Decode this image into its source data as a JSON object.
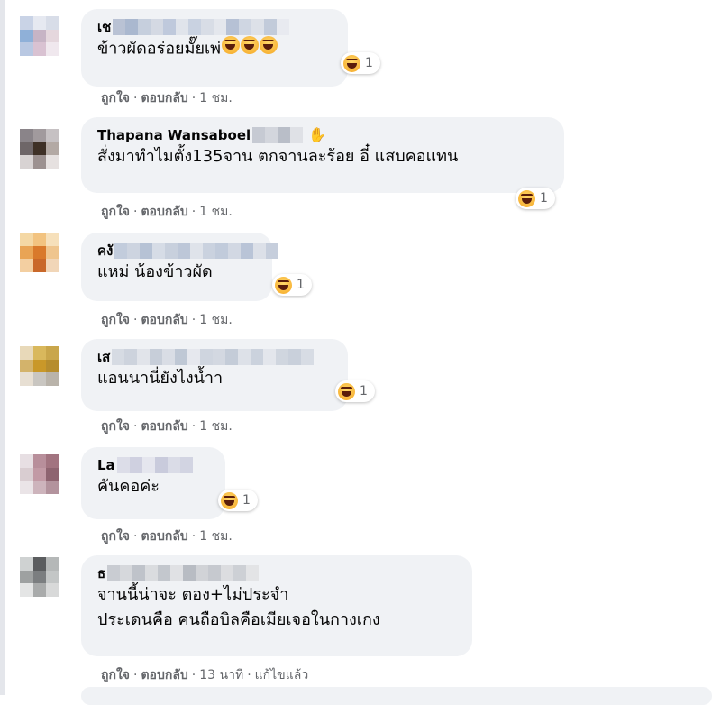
{
  "comments": [
    {
      "name": "เช",
      "text": "ข้าวผัดอร่อยมั๊ยเพ่",
      "reaction_count": "1",
      "meta": {
        "like": "ถูกใจ",
        "reply": "ตอบกลับ",
        "time": "1 ชม."
      },
      "avatar_colors": [
        "#c9d3e6",
        "#e6e9f1",
        "#d8dde8",
        "#8fb0d8",
        "#c7b4c5",
        "#e5d7dd",
        "#b9c8e2",
        "#d9c2d2",
        "#f0e8ee"
      ],
      "blur_colors": [
        "#b9c2d4",
        "#aab8cf",
        "#c6cfdd",
        "#d4d9e3",
        "#bfc9dc",
        "#e0e4eb",
        "#c9d2e1",
        "#d8dde6",
        "#e4e7ed",
        "#b6c1d5",
        "#cfd6e2",
        "#dde1e8",
        "#c2cbda",
        "#e8eaf0"
      ]
    },
    {
      "name": "Thapana Wansaboel",
      "text": "สั่งมาทำไมตั้ง135จาน ตกจานละร้อย อี๋ แสบคอแทน",
      "reaction_count": "1",
      "meta": {
        "like": "ถูกใจ",
        "reply": "ตอบกลับ",
        "time": "1 ชม."
      },
      "avatar_colors": [
        "#8a8489",
        "#a19a9d",
        "#c6c1c3",
        "#6e6668",
        "#3e3026",
        "#b3a9a4",
        "#d8d3d3",
        "#9c9190",
        "#e6e1e0"
      ],
      "blur_colors": [
        "#c6cad3",
        "#d3d6dd",
        "#b9bec8",
        "#dfe1e6"
      ]
    },
    {
      "name": "คงั",
      "text": "แหม่ น้องข้าวผัด",
      "reaction_count": "1",
      "meta": {
        "like": "ถูกใจ",
        "reply": "ตอบกลับ",
        "time": "1 ชม."
      },
      "avatar_colors": [
        "#f4d8a5",
        "#f2c380",
        "#f6e0bb",
        "#e9a455",
        "#d9792b",
        "#efc58e",
        "#f3cfa1",
        "#c9682a",
        "#f1d6b8"
      ],
      "blur_colors": [
        "#c2ccdc",
        "#cdd4e0",
        "#b6c2d5",
        "#d6dce6",
        "#c8d0dd",
        "#bdc7d8",
        "#dfe3ea",
        "#cad2df",
        "#c1cbdb",
        "#d2d8e3",
        "#b9c4d7",
        "#dce0e8",
        "#c6cedc"
      ]
    },
    {
      "name": "เส",
      "text": "แอนนานี่ยังไงน้ำา",
      "reaction_count": "1",
      "meta": {
        "like": "ถูกใจ",
        "reply": "ตอบกลับ",
        "time": "1 ชม."
      },
      "avatar_colors": [
        "#e8d9b9",
        "#d9b85c",
        "#c9a64b",
        "#d3b36b",
        "#c99829",
        "#b68d2e",
        "#e7dfd3",
        "#c9c6c1",
        "#b9b3aa"
      ],
      "blur_colors": [
        "#d6dbe3",
        "#cdd3dd",
        "#e1e4ea",
        "#c7ced9",
        "#d9dde5",
        "#bfc8d5",
        "#e6e8ee",
        "#cfd5df",
        "#d3d8e1",
        "#c4ccd8",
        "#dde1e8",
        "#cbd2dd",
        "#e3e6ec",
        "#d0d6df",
        "#c9d0db",
        "#d7dce4"
      ]
    },
    {
      "name": "La",
      "text": "คันคอค่ะ",
      "reaction_count": "1",
      "meta": {
        "like": "ถูกใจ",
        "reply": "ตอบกลับ",
        "time": "1 ชม."
      },
      "avatar_colors": [
        "#e7dfe3",
        "#b88f9b",
        "#a27480",
        "#d9cdd1",
        "#c29aa5",
        "#8e6470",
        "#eae4e7",
        "#cdb4bc",
        "#b3939d"
      ],
      "blur_colors": [
        "#dcdde8",
        "#cfd0e0",
        "#e5e6ee",
        "#c9cbdc",
        "#dadce7",
        "#d2d4e2"
      ]
    },
    {
      "name": "ธ",
      "text_lines": [
        "จานนี้น่าจะ ตอง+ไม่ประจำ",
        "ประเดนคือ คนถือบิลคือเมียเจอในกางเกง"
      ],
      "meta": {
        "like": "ถูกใจ",
        "reply": "ตอบกลับ",
        "time": "13 นาที",
        "edited": "แก้ไขแล้ว"
      },
      "avatar_colors": [
        "#cfd2d2",
        "#5b5d5f",
        "#b5b8b8",
        "#9ea1a1",
        "#7b7e80",
        "#c3c6c6",
        "#e4e5e5",
        "#a9abab",
        "#d8d9d9"
      ],
      "blur_colors": [
        "#c9ccd2",
        "#d6d8dc",
        "#bfc3ca",
        "#dadcdf",
        "#c3c7cd",
        "#e0e1e4",
        "#b8bcc3",
        "#d1d3d7",
        "#c6c9cf",
        "#dcdde0",
        "#cdd0d5",
        "#e3e4e6"
      ]
    }
  ],
  "separator": "·"
}
